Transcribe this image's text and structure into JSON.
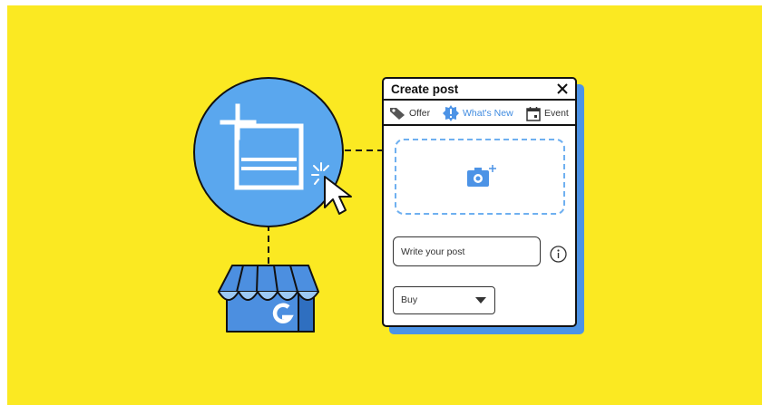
{
  "colors": {
    "background": "#fbe922",
    "accent_blue": "#4c93e6",
    "light_blue": "#5aa7ee",
    "outline": "#111111"
  },
  "dialog": {
    "title": "Create post",
    "close_icon": "close-icon",
    "tabs": [
      {
        "label": "Offer",
        "icon": "tag-icon",
        "active": false
      },
      {
        "label": "What's New",
        "icon": "badge-info-icon",
        "active": true
      },
      {
        "label": "Event",
        "icon": "calendar-icon",
        "active": false
      }
    ],
    "upload_icon": "camera-add-icon",
    "post_input": {
      "placeholder": "Write your post",
      "value": ""
    },
    "info_icon": "info-icon",
    "action_select": {
      "value": "Buy",
      "icon": "chevron-down-icon"
    }
  },
  "illustration": {
    "post_icon": "add-post-icon",
    "cursor_icon": "mouse-pointer-icon",
    "store_icon": "storefront-icon",
    "store_logo": "G"
  }
}
